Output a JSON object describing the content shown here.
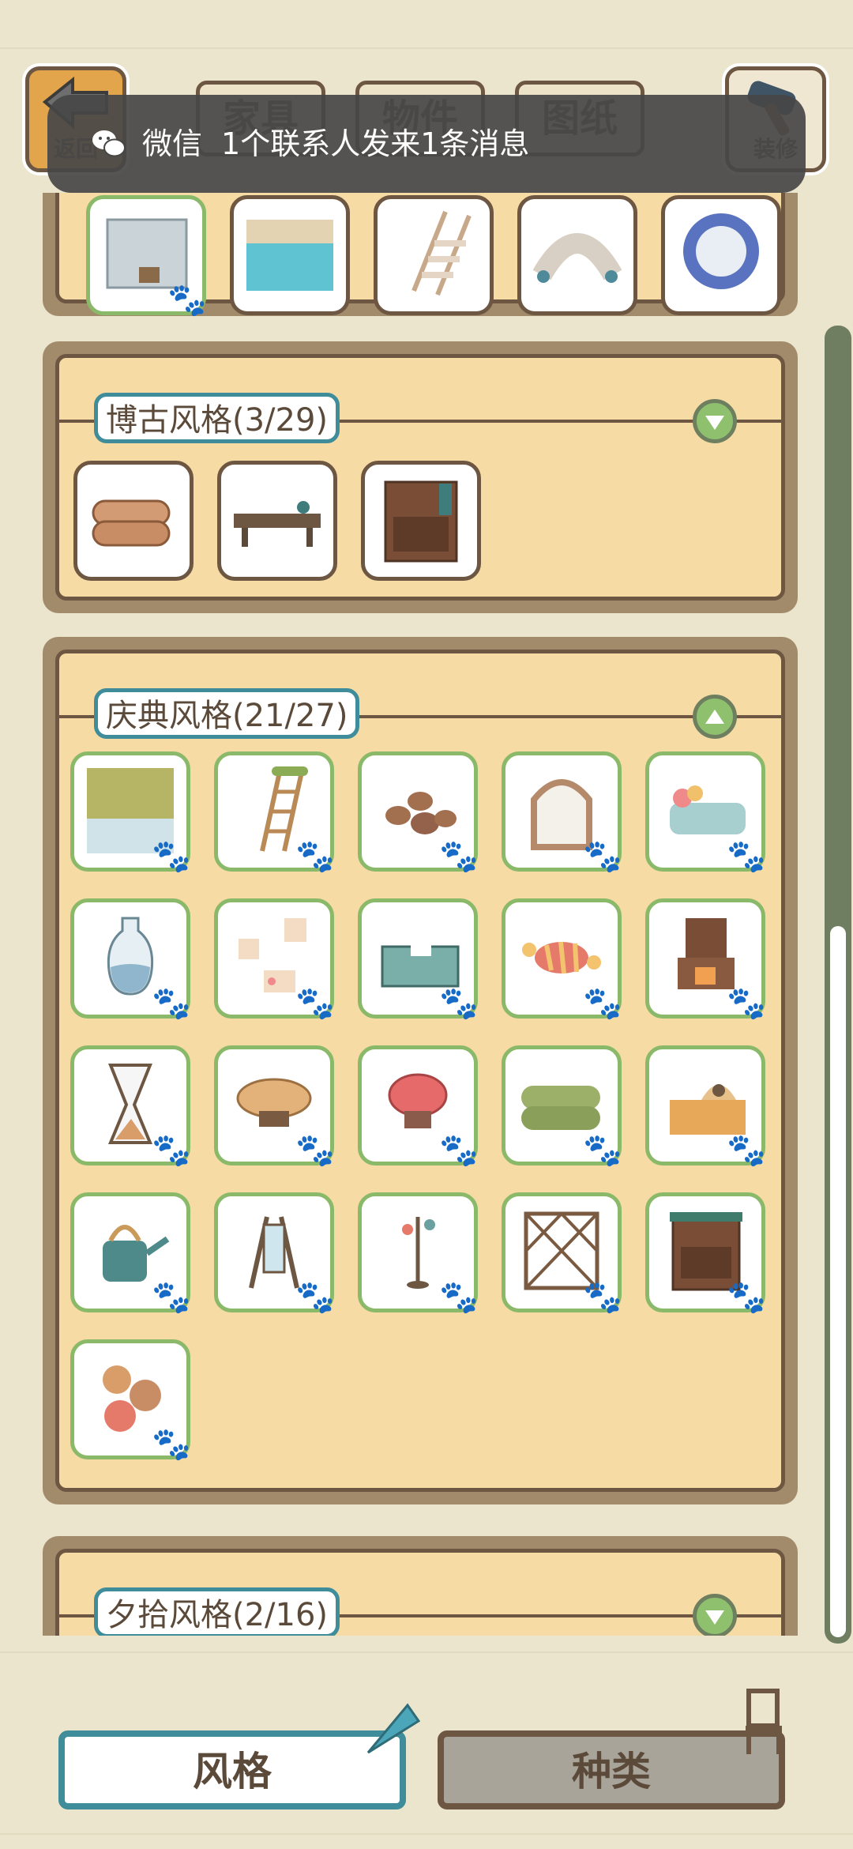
{
  "top_bar": {
    "back_label": "返回",
    "decor_label": "装修",
    "tabs": [
      {
        "label": "家具"
      },
      {
        "label": "物件"
      },
      {
        "label": "图纸"
      }
    ]
  },
  "notification": {
    "app": "微信",
    "message": "1个联系人发来1条消息",
    "icon": "wechat-icon"
  },
  "sections": [
    {
      "title": "博古风格(3/29)",
      "toggle": "chevron-down-icon"
    },
    {
      "title": "庆典风格(21/27)",
      "toggle": "chevron-up-icon"
    },
    {
      "title": "夕拾风格(2/16)",
      "toggle": "chevron-down-icon"
    }
  ],
  "bottom_tabs": {
    "style_label": "风格",
    "kind_label": "种类"
  },
  "colors": {
    "background": "#ebe5cd",
    "panel": "#f7dba4",
    "owned_border": "#8bb96a",
    "accent": "#3f8c9a",
    "brown": "#6d5742"
  }
}
